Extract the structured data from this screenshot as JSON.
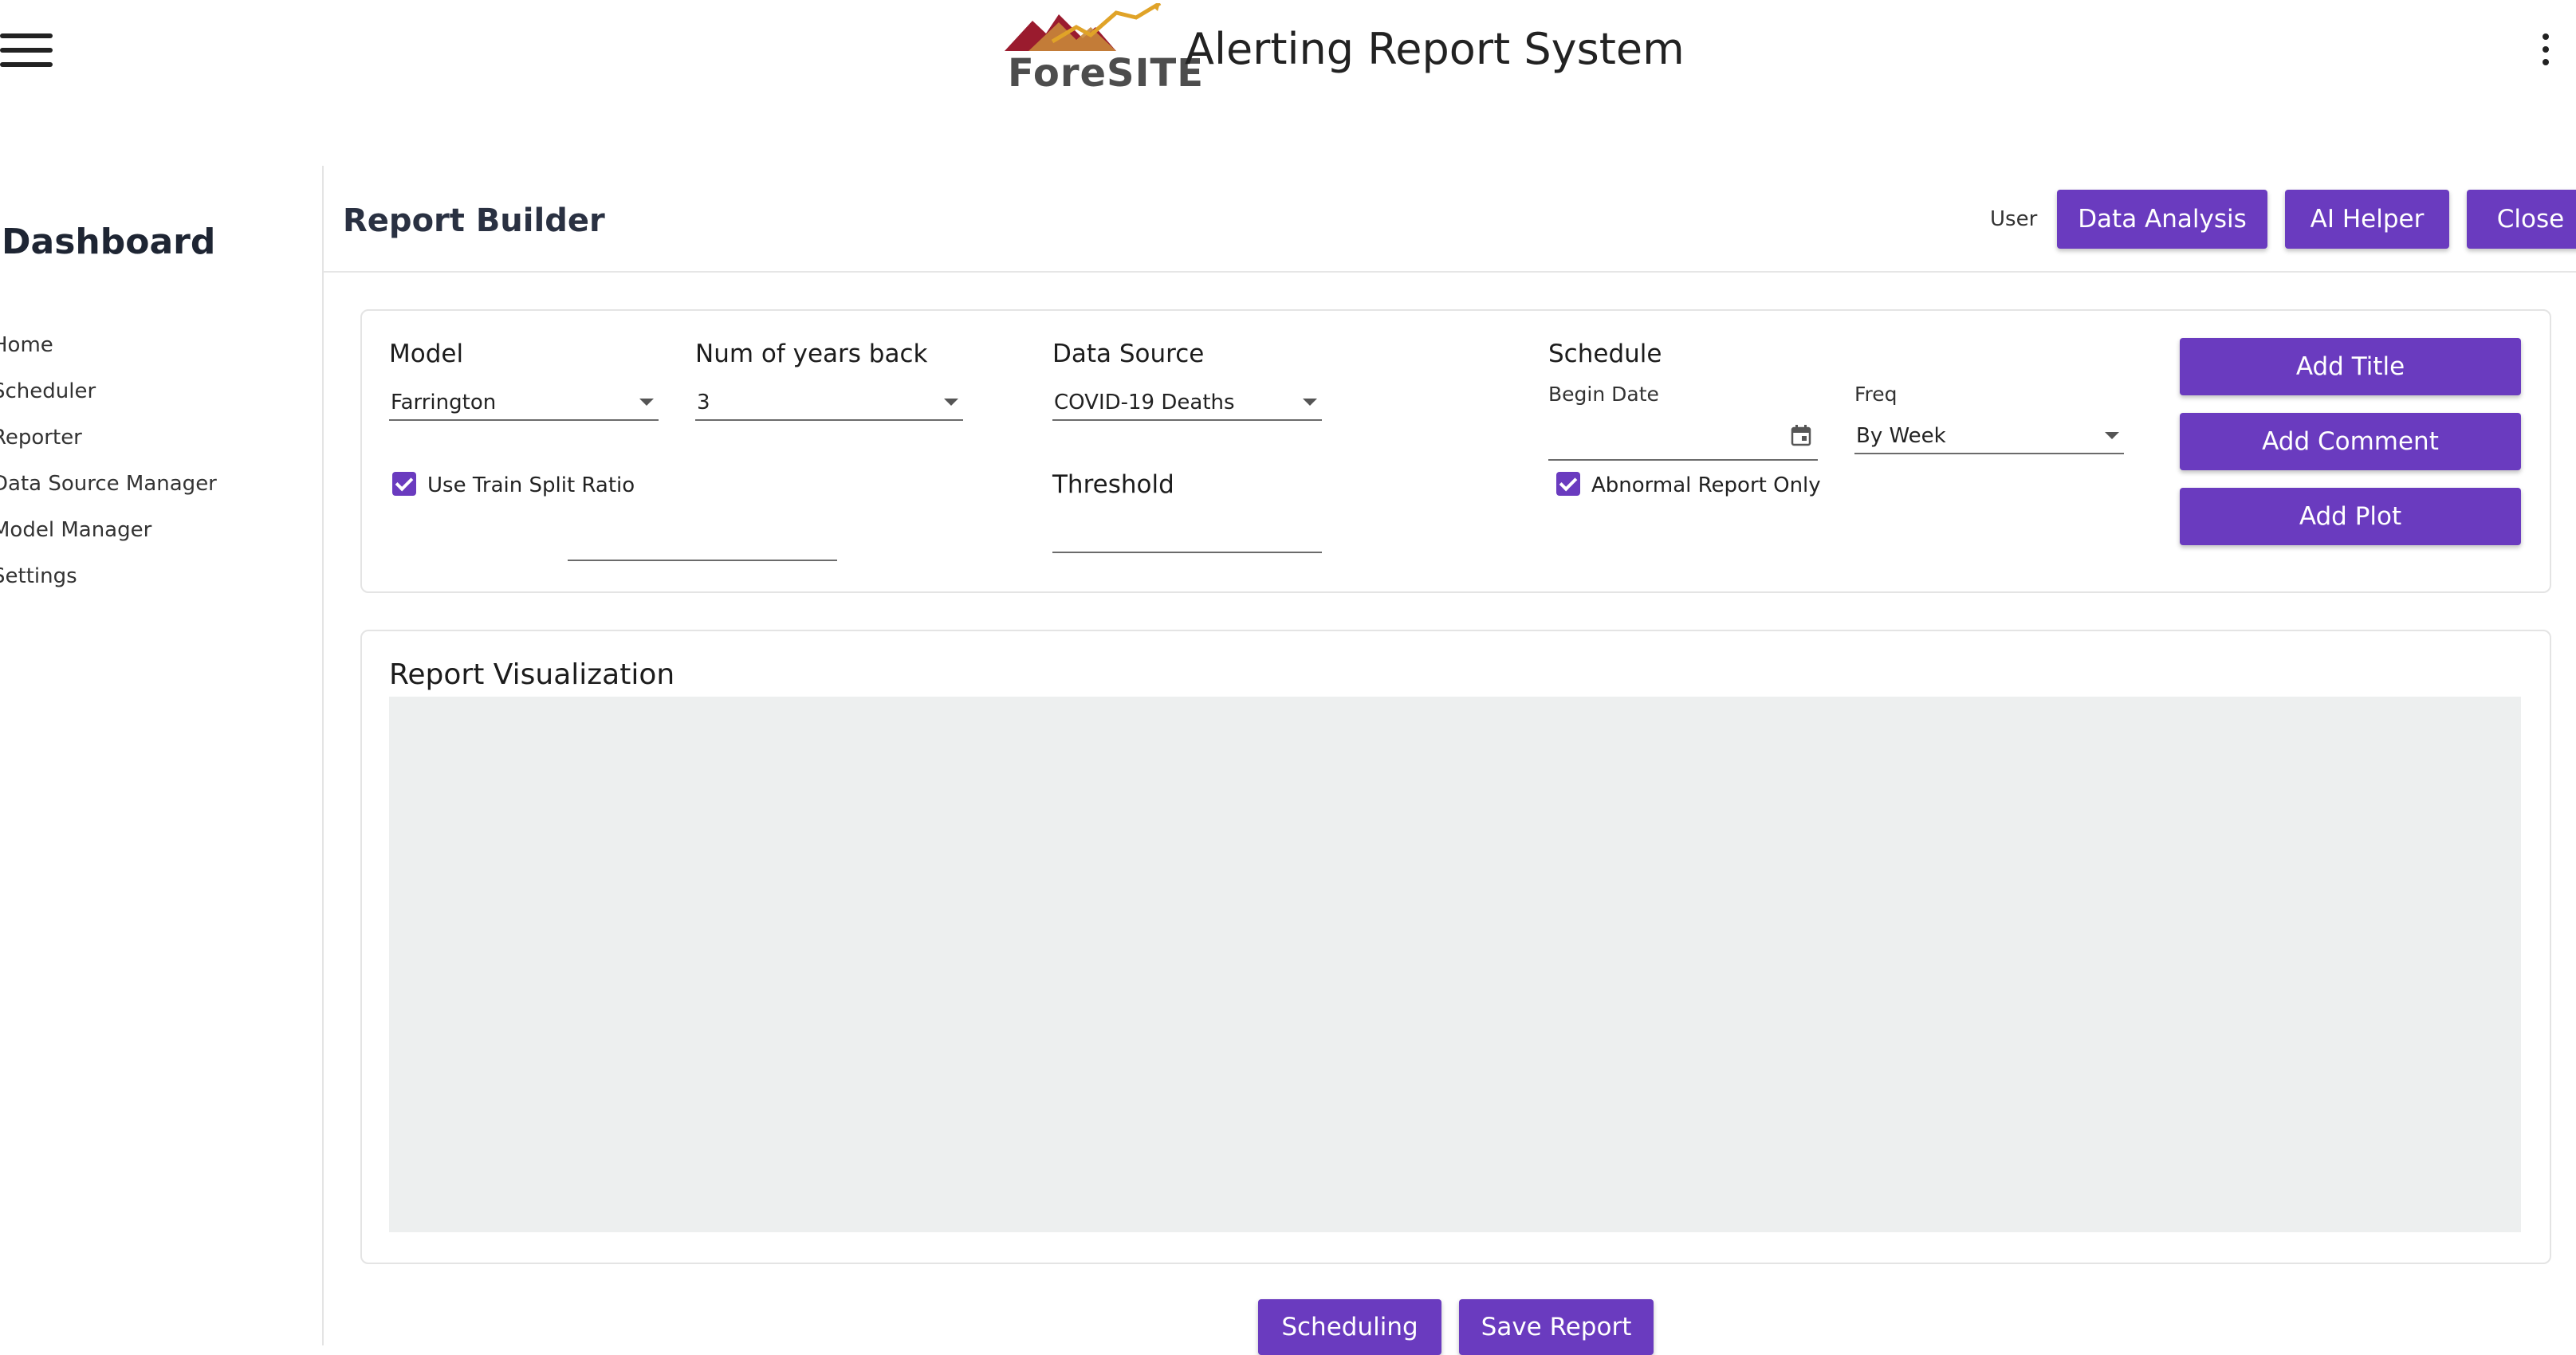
{
  "header": {
    "logo_text": "ForeSITE",
    "app_title": "Alerting Report System"
  },
  "sidebar": {
    "title": "Dashboard",
    "items": [
      {
        "label": "Home"
      },
      {
        "label": "Scheduler"
      },
      {
        "label": "Reporter"
      },
      {
        "label": "Data Source Manager"
      },
      {
        "label": "Model Manager"
      },
      {
        "label": "Settings"
      }
    ]
  },
  "page": {
    "title": "Report Builder",
    "user_label": "User",
    "buttons": {
      "data_analysis": "Data Analysis",
      "ai_helper": "AI Helper",
      "close": "Close"
    }
  },
  "config": {
    "model": {
      "label": "Model",
      "value": "Farrington"
    },
    "years_back": {
      "label": "Num of years back",
      "value": "3"
    },
    "data_source": {
      "label": "Data Source",
      "value": "COVID-19 Deaths"
    },
    "schedule": {
      "label": "Schedule",
      "begin_date_label": "Begin Date",
      "begin_date_value": "",
      "freq_label": "Freq",
      "freq_value": "By Week"
    },
    "use_train_split": {
      "label": "Use Train Split Ratio",
      "checked": true
    },
    "threshold": {
      "label": "Threshold",
      "value": ""
    },
    "abnormal_only": {
      "label": "Abnormal Report Only",
      "checked": true
    },
    "actions": {
      "add_title": "Add Title",
      "add_comment": "Add Comment",
      "add_plot": "Add Plot"
    }
  },
  "visualization": {
    "title": "Report Visualization"
  },
  "footer": {
    "scheduling": "Scheduling",
    "save_report": "Save Report"
  },
  "colors": {
    "accent": "#6a3bbf",
    "viz_background": "#edefef"
  }
}
